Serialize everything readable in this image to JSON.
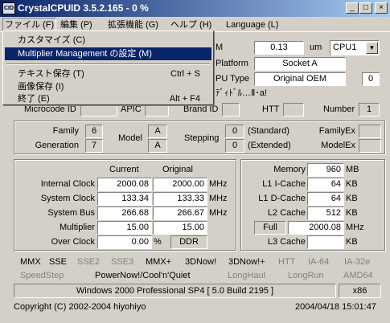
{
  "window": {
    "title": "CrystalCPUID 3.5.2.165 - 0 %",
    "icon_text": "CID"
  },
  "menubar": [
    "ファイル (F)",
    "編集 (P)",
    "拡張機能 (G)",
    "ヘルプ (H)",
    "Language (L)"
  ],
  "file_menu": {
    "items": [
      {
        "label": "カスタマイズ (C)",
        "shortcut": ""
      },
      {
        "label": "Multiplier Management の設定 (M)",
        "shortcut": ""
      },
      {
        "label": "テキスト保存 (T)",
        "shortcut": "Ctrl + S"
      },
      {
        "label": "画像保存 (I)",
        "shortcut": ""
      },
      {
        "label": "終了 (E)",
        "shortcut": "Alt + F4"
      }
    ]
  },
  "top": {
    "m_label": "M",
    "freq_value": "0.13",
    "freq_unit": "um",
    "cpu_select": "CPU1",
    "platform_label": "Platform",
    "platform_value": "Socket A",
    "type_label": "PU Type",
    "type_value": "Original OEM",
    "type_extra": "0",
    "name_text": "ﾃﾞｨﾄﾞﾙ…Ⅱ･a!",
    "microcode_label": "Microcode ID",
    "apic_label": "APIC",
    "brand_label": "Brand ID",
    "htt_label": "HTT",
    "number_label": "Number",
    "number_value": "1"
  },
  "cpu_id": {
    "family_label": "Family",
    "family_value": "6",
    "generation_label": "Generation",
    "generation_value": "7",
    "model_label": "Model",
    "model_a": "A",
    "model_b": "A",
    "stepping_label": "Stepping",
    "stepping_a": "0",
    "stepping_b": "0",
    "standard": "(Standard)",
    "extended": "(Extended)",
    "familyex_label": "FamilyEx",
    "modelex_label": "ModelEx"
  },
  "clocks": {
    "current_header": "Current",
    "original_header": "Original",
    "rows": [
      {
        "label": "Internal Clock",
        "current": "2000.08",
        "original": "2000.00",
        "unit": "MHz"
      },
      {
        "label": "System Clock",
        "current": "133.34",
        "original": "133.33",
        "unit": "MHz"
      },
      {
        "label": "System Bus",
        "current": "266.68",
        "original": "266.67",
        "unit": "MHz"
      },
      {
        "label": "Multiplier",
        "current": "15.00",
        "original": "15.00",
        "unit": ""
      },
      {
        "label": "Over Clock",
        "current": "0.00",
        "original": "DDR",
        "unit": "%"
      }
    ]
  },
  "memory": {
    "rows": [
      {
        "label": "Memory",
        "value": "960",
        "unit": "MB"
      },
      {
        "label": "L1 I-Cache",
        "value": "64",
        "unit": "KB"
      },
      {
        "label": "L1 D-Cache",
        "value": "64",
        "unit": "KB"
      },
      {
        "label": "L2 Cache",
        "value": "512",
        "unit": "KB"
      }
    ],
    "full_label": "Full",
    "full_value": "2000.08",
    "full_unit": "MHz",
    "l3_label": "L3 Cache",
    "l3_unit": "KB"
  },
  "features": {
    "row1": [
      {
        "t": "MMX",
        "on": true
      },
      {
        "t": "SSE",
        "on": true
      },
      {
        "t": "SSE2",
        "on": false
      },
      {
        "t": "SSE3",
        "on": false
      },
      {
        "t": "MMX+",
        "on": true
      },
      {
        "t": "3DNow!",
        "on": true
      },
      {
        "t": "3DNow!+",
        "on": true
      },
      {
        "t": "HTT",
        "on": false
      },
      {
        "t": "IA-64",
        "on": false
      },
      {
        "t": "IA-32e",
        "on": false
      }
    ],
    "row2": [
      {
        "t": "SpeedStep",
        "on": false
      },
      {
        "t": "PowerNow!/Cool'n'Quiet",
        "on": true
      },
      {
        "t": "LongHaul",
        "on": false
      },
      {
        "t": "LongRun",
        "on": false
      },
      {
        "t": "AMD64",
        "on": false
      }
    ]
  },
  "status": {
    "os": "Windows 2000 Professional SP4 [ 5.0 Build 2195 ]",
    "arch": "x86"
  },
  "footer": {
    "copyright": "Copyright (C) 2002-2004 hiyohiyo",
    "datetime": "2004/04/18 15:01:47"
  },
  "colors": {
    "title_start": "#0a246a",
    "title_end": "#a6caf0",
    "face": "#d4d0c8",
    "disabled": "#808080"
  }
}
